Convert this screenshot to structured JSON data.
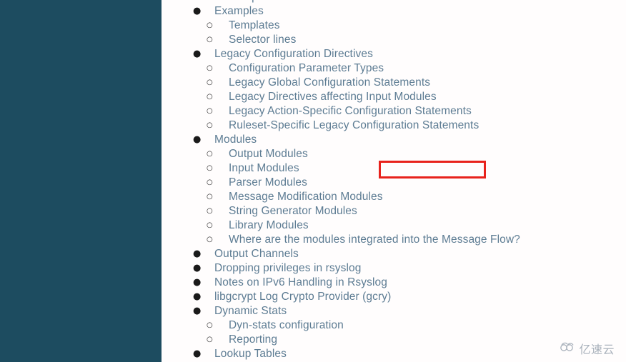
{
  "colors": {
    "sidebar_bg": "#1d4c60",
    "content_bg": "#fffdfd",
    "link_text": "#5d7c93",
    "bullet": "#1a1a1a",
    "highlight_border": "#e8221c",
    "watermark_text": "#9aa4b0"
  },
  "sidebar": {
    "label": ""
  },
  "toc": {
    "items": [
      {
        "level": 2,
        "label": "Sample"
      },
      {
        "level": 1,
        "label": "Examples"
      },
      {
        "level": 2,
        "label": "Templates"
      },
      {
        "level": 2,
        "label": "Selector lines"
      },
      {
        "level": 1,
        "label": "Legacy Configuration Directives"
      },
      {
        "level": 2,
        "label": "Configuration Parameter Types"
      },
      {
        "level": 2,
        "label": "Legacy Global Configuration Statements"
      },
      {
        "level": 2,
        "label": "Legacy Directives affecting Input Modules"
      },
      {
        "level": 2,
        "label": "Legacy Action-Specific Configuration Statements"
      },
      {
        "level": 2,
        "label": "Ruleset-Specific Legacy Configuration Statements"
      },
      {
        "level": 1,
        "label": "Modules"
      },
      {
        "level": 2,
        "label": "Output Modules"
      },
      {
        "level": 2,
        "label": "Input Modules"
      },
      {
        "level": 2,
        "label": "Parser Modules"
      },
      {
        "level": 2,
        "label": "Message Modification Modules"
      },
      {
        "level": 2,
        "label": "String Generator Modules"
      },
      {
        "level": 2,
        "label": "Library Modules"
      },
      {
        "level": 2,
        "label": "Where are the modules integrated into the Message Flow?"
      },
      {
        "level": 1,
        "label": "Output Channels"
      },
      {
        "level": 1,
        "label": "Dropping privileges in rsyslog"
      },
      {
        "level": 1,
        "label": "Notes on IPv6 Handling in Rsyslog"
      },
      {
        "level": 1,
        "label": "libgcrypt Log Crypto Provider (gcry)"
      },
      {
        "level": 1,
        "label": "Dynamic Stats"
      },
      {
        "level": 2,
        "label": "Dyn-stats configuration"
      },
      {
        "level": 2,
        "label": "Reporting"
      },
      {
        "level": 1,
        "label": "Lookup Tables"
      }
    ],
    "highlighted_label": "Input Modules"
  },
  "watermark": {
    "text": "亿速云",
    "icon": "cloud-icon"
  }
}
